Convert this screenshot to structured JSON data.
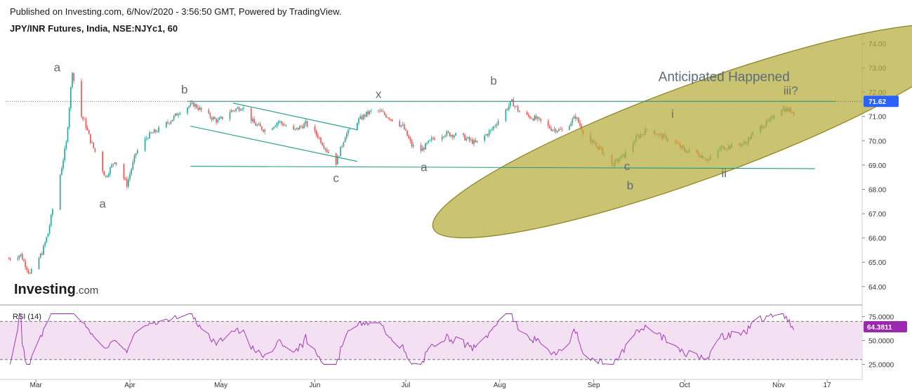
{
  "header": {
    "published": "Published on Investing.com, 6/Nov/2020 - 3:56:50 GMT, Powered by TradingView.",
    "instrument": "JPY/INR Futures, India, NSE:NJYc1, 60"
  },
  "colors": {
    "up": "#26a69a",
    "down": "#ef5350",
    "trend_line": "#1e9a86",
    "resistance_line": "#2a8f7f",
    "ellipse_fill": "#b6ad3c",
    "ellipse_stroke": "#8a8222",
    "wave_label": "#5d6b78",
    "rsi_line": "#9c27b0",
    "rsi_band": "#f3e1f3",
    "rsi_badge": "#9c27b0",
    "price_badge": "#2962ff"
  },
  "chart_data": [
    {
      "type": "candlestick",
      "title": "JPY/INR Futures, India, NSE:NJYc1, 60",
      "x_tick_labels": [
        "Mar",
        "Apr",
        "May",
        "Jun",
        "Jul",
        "Aug",
        "Sep",
        "Oct",
        "Nov",
        "17"
      ],
      "y_tick_labels": [
        "74.00",
        "73.00",
        "72.00",
        "71.00",
        "70.00",
        "69.00",
        "68.00",
        "67.00",
        "66.00",
        "65.00",
        "64.00"
      ],
      "ylim": [
        63.3,
        74.2
      ],
      "last_price": "71.62",
      "close_path": [
        {
          "x": "2020-02-21",
          "y": 65.15
        },
        {
          "x": "2020-02-25",
          "y": 65.3
        },
        {
          "x": "2020-02-28",
          "y": 64.5
        },
        {
          "x": "2020-03-03",
          "y": 65.4
        },
        {
          "x": "2020-03-05",
          "y": 66.2
        },
        {
          "x": "2020-03-07",
          "y": 67.5
        },
        {
          "x": "2020-03-09",
          "y": 68.6
        },
        {
          "x": "2020-03-11",
          "y": 69.9
        },
        {
          "x": "2020-03-13",
          "y": 72.9
        },
        {
          "x": "2020-03-15",
          "y": 71.2
        },
        {
          "x": "2020-03-17",
          "y": 70.8
        },
        {
          "x": "2020-03-19",
          "y": 70.0
        },
        {
          "x": "2020-03-21",
          "y": 69.4
        },
        {
          "x": "2020-03-24",
          "y": 68.5
        },
        {
          "x": "2020-03-27",
          "y": 69.2
        },
        {
          "x": "2020-03-31",
          "y": 68.2
        },
        {
          "x": "2020-04-03",
          "y": 69.5
        },
        {
          "x": "2020-04-07",
          "y": 70.2
        },
        {
          "x": "2020-04-11",
          "y": 70.5
        },
        {
          "x": "2020-04-15",
          "y": 70.9
        },
        {
          "x": "2020-04-18",
          "y": 71.3
        },
        {
          "x": "2020-04-22",
          "y": 71.5
        },
        {
          "x": "2020-04-26",
          "y": 71.1
        },
        {
          "x": "2020-04-30",
          "y": 70.8
        },
        {
          "x": "2020-05-04",
          "y": 71.2
        },
        {
          "x": "2020-05-08",
          "y": 71.4
        },
        {
          "x": "2020-05-12",
          "y": 70.7
        },
        {
          "x": "2020-05-16",
          "y": 70.4
        },
        {
          "x": "2020-05-20",
          "y": 70.8
        },
        {
          "x": "2020-05-25",
          "y": 70.4
        },
        {
          "x": "2020-05-29",
          "y": 70.7
        },
        {
          "x": "2020-06-02",
          "y": 70.2
        },
        {
          "x": "2020-06-05",
          "y": 69.6
        },
        {
          "x": "2020-06-08",
          "y": 69.1
        },
        {
          "x": "2020-06-11",
          "y": 70.2
        },
        {
          "x": "2020-06-15",
          "y": 70.8
        },
        {
          "x": "2020-06-18",
          "y": 71.1
        },
        {
          "x": "2020-06-21",
          "y": 71.3
        },
        {
          "x": "2020-06-25",
          "y": 71.0
        },
        {
          "x": "2020-06-30",
          "y": 70.6
        },
        {
          "x": "2020-07-03",
          "y": 69.8
        },
        {
          "x": "2020-07-06",
          "y": 69.6
        },
        {
          "x": "2020-07-10",
          "y": 70.1
        },
        {
          "x": "2020-07-14",
          "y": 70.3
        },
        {
          "x": "2020-07-19",
          "y": 70.2
        },
        {
          "x": "2020-07-24",
          "y": 69.9
        },
        {
          "x": "2020-07-29",
          "y": 70.4
        },
        {
          "x": "2020-08-02",
          "y": 71.1
        },
        {
          "x": "2020-08-05",
          "y": 71.6
        },
        {
          "x": "2020-08-08",
          "y": 71.1
        },
        {
          "x": "2020-08-13",
          "y": 70.9
        },
        {
          "x": "2020-08-18",
          "y": 70.5
        },
        {
          "x": "2020-08-22",
          "y": 70.4
        },
        {
          "x": "2020-08-26",
          "y": 71.0
        },
        {
          "x": "2020-08-30",
          "y": 70.0
        },
        {
          "x": "2020-09-03",
          "y": 69.7
        },
        {
          "x": "2020-09-07",
          "y": 69.0
        },
        {
          "x": "2020-09-11",
          "y": 69.4
        },
        {
          "x": "2020-09-15",
          "y": 70.1
        },
        {
          "x": "2020-09-19",
          "y": 70.5
        },
        {
          "x": "2020-09-23",
          "y": 70.2
        },
        {
          "x": "2020-09-27",
          "y": 70.0
        },
        {
          "x": "2020-10-01",
          "y": 69.6
        },
        {
          "x": "2020-10-05",
          "y": 69.5
        },
        {
          "x": "2020-10-09",
          "y": 69.2
        },
        {
          "x": "2020-10-13",
          "y": 69.7
        },
        {
          "x": "2020-10-17",
          "y": 69.8
        },
        {
          "x": "2020-10-21",
          "y": 69.9
        },
        {
          "x": "2020-10-25",
          "y": 70.5
        },
        {
          "x": "2020-10-29",
          "y": 70.8
        },
        {
          "x": "2020-11-01",
          "y": 71.4
        },
        {
          "x": "2020-11-03",
          "y": 71.3
        },
        {
          "x": "2020-11-06",
          "y": 71.2
        }
      ],
      "horizontal_lines": [
        {
          "y": 71.62,
          "style": "dotted",
          "from": "2020-02-20",
          "to": "2020-12-01"
        },
        {
          "y": 71.62,
          "style": "solid",
          "from": "2020-04-20",
          "to": "2020-11-06"
        }
      ],
      "trend_lines": [
        {
          "from": {
            "x": "2020-04-21",
            "y": 70.6
          },
          "to": {
            "x": "2020-06-15",
            "y": 69.15
          }
        },
        {
          "from": {
            "x": "2020-05-05",
            "y": 71.55
          },
          "to": {
            "x": "2020-06-15",
            "y": 70.45
          }
        },
        {
          "from": {
            "x": "2020-04-21",
            "y": 68.95
          },
          "to": {
            "x": "2020-11-13",
            "y": 68.85
          }
        }
      ],
      "ellipse": {
        "center": {
          "x": "2020-10-06",
          "y": 70.4
        },
        "rx_days": 36,
        "ry": 1.95,
        "rotation_deg": -20
      },
      "annotations": [
        {
          "text": "a",
          "x": "2020-03-08",
          "y": 72.85
        },
        {
          "text": "a",
          "x": "2020-03-23",
          "y": 67.25
        },
        {
          "text": "b",
          "x": "2020-04-19",
          "y": 71.95
        },
        {
          "text": "c",
          "x": "2020-06-08",
          "y": 68.3
        },
        {
          "text": "x",
          "x": "2020-06-22",
          "y": 71.75
        },
        {
          "text": "a",
          "x": "2020-07-07",
          "y": 68.75
        },
        {
          "text": "b",
          "x": "2020-07-30",
          "y": 72.3
        },
        {
          "text": "c",
          "x": "2020-09-12",
          "y": 68.8
        },
        {
          "text": "b",
          "x": "2020-09-13",
          "y": 68.0
        },
        {
          "text": "i",
          "x": "2020-09-27",
          "y": 70.95
        },
        {
          "text": "ii",
          "x": "2020-10-14",
          "y": 68.5
        },
        {
          "text": "iii?",
          "x": "2020-11-05",
          "y": 71.9
        },
        {
          "text": "Anticipated Happened",
          "x": "2020-10-14",
          "y": 72.45
        }
      ]
    },
    {
      "type": "line",
      "title": "RSI (14)",
      "y_tick_labels": [
        "75.0000",
        "50.0000",
        "25.0000"
      ],
      "ylim": [
        18,
        85
      ],
      "overbought": 70,
      "oversold": 30,
      "last_value": "64.3811",
      "range": [
        25,
        78
      ]
    }
  ],
  "logo": {
    "brand": "Investing",
    "suffix": ".com"
  }
}
